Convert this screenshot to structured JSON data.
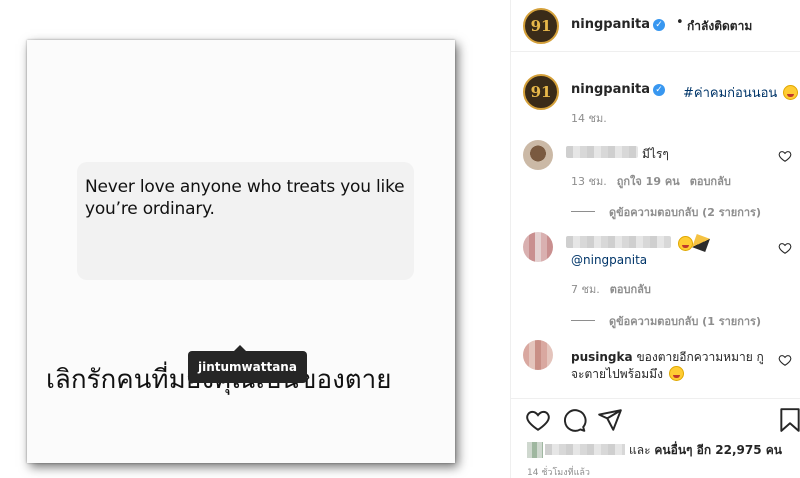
{
  "post": {
    "quote_text": "Never love anyone who treats you like you’re ordinary.",
    "thai_caption": "เลิกรักคนที่มองคุณเป็นของตาย",
    "tag_username": "jintumwattana"
  },
  "header": {
    "avatar_text": "91",
    "username": "ningpanita",
    "verified_mark": "✓",
    "separator": "•",
    "follow_state": "กำลังติดตาม"
  },
  "caption": {
    "avatar_text": "91",
    "username": "ningpanita",
    "verified_mark": "✓",
    "hashtag": "#ค่าคมก่อนนอน",
    "time": "14 ชม."
  },
  "comments": [
    {
      "text": "มีไรๆ",
      "time": "13 ชม.",
      "likes": "ถูกใจ 19 คน",
      "reply_label": "ตอบกลับ",
      "view_replies": "ดูข้อความตอบกลับ (2 รายการ)"
    },
    {
      "mention": "@ningpanita",
      "time": "7 ชม.",
      "reply_label": "ตอบกลับ",
      "view_replies": "ดูข้อความตอบกลับ (1 รายการ)"
    },
    {
      "username": "pusingka",
      "text_line1": "ของตายอีกความหมาย กู",
      "text_line2": "จะตายไปพร้อมมึง"
    }
  ],
  "footer": {
    "likes_text": "และ",
    "likes_others": "คนอื่นๆ อีก 22,975 คน",
    "posted_time": "14 ชั่วโมงที่แล้ว"
  },
  "icons": {
    "like": "heart-icon",
    "comment": "comment-icon",
    "share": "share-icon",
    "save": "bookmark-icon"
  },
  "colors": {
    "verified": "#3897f0",
    "link": "#003569",
    "secondary_text": "#8e8e8e"
  }
}
